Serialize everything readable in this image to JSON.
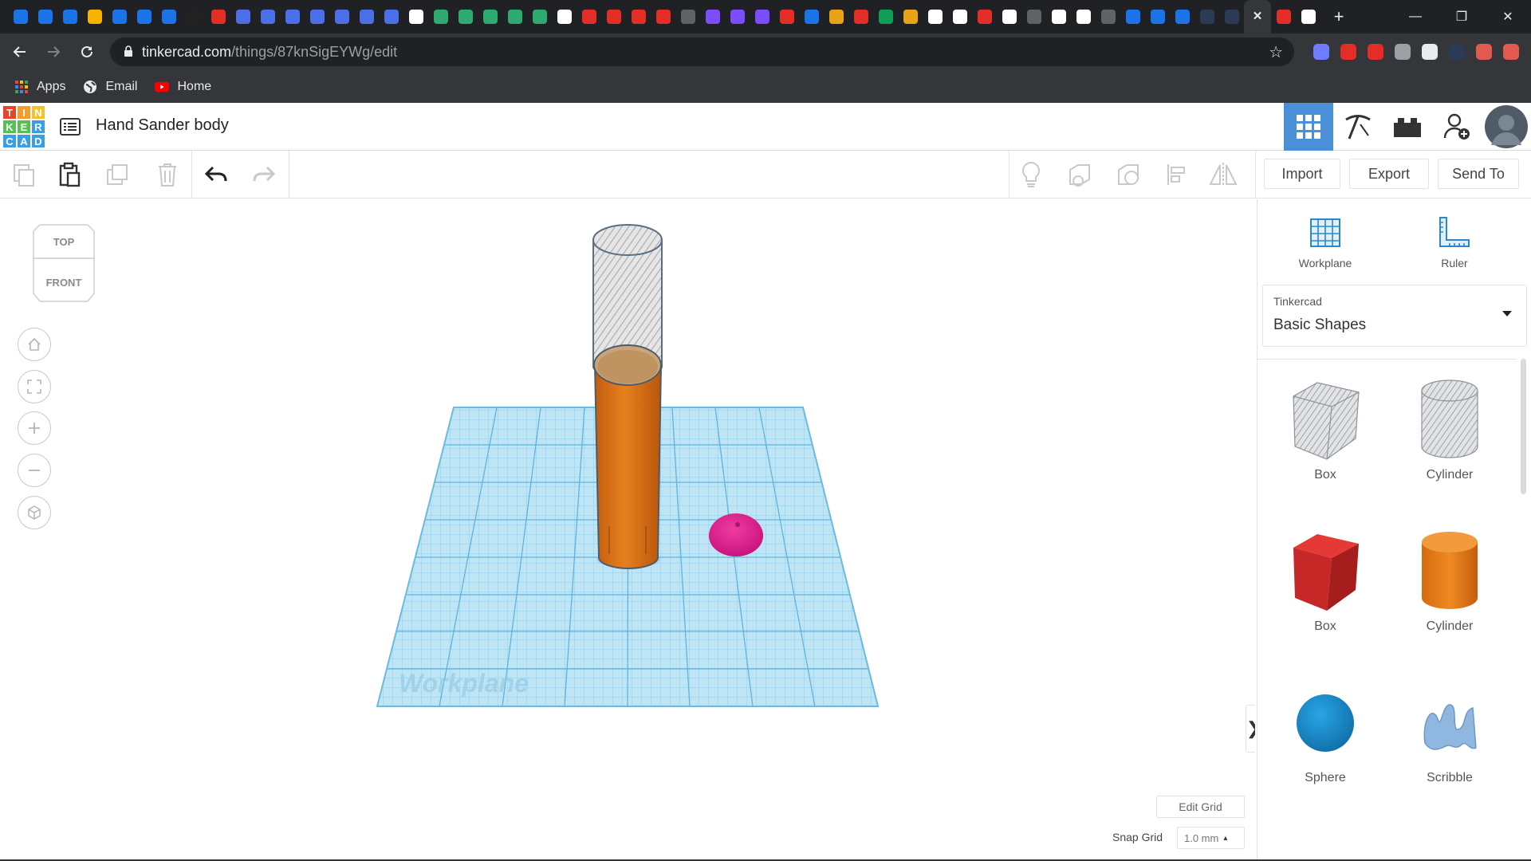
{
  "browser": {
    "tab_favicon_colors": [
      "#1a73e8",
      "#1a73e8",
      "#1a73e8",
      "#f6b400",
      "#1a73e8",
      "#1a73e8",
      "#1a73e8",
      "#222222",
      "#e52d27",
      "#4a6fe8",
      "#4a6fe8",
      "#4a6fe8",
      "#4a6fe8",
      "#4a6fe8",
      "#4a6fe8",
      "#4a6fe8",
      "#ffffff",
      "#2ea96f",
      "#2ea96f",
      "#2ea96f",
      "#2ea96f",
      "#2ea96f",
      "#ffffff",
      "#e52d27",
      "#e52d27",
      "#e52d27",
      "#e52d27",
      "#5f6368",
      "#7c4dff",
      "#7c4dff",
      "#7c4dff",
      "#e52d27",
      "#1a73e8",
      "#e8a317",
      "#e52d27",
      "#0f9d58",
      "#e8a317",
      "#ffffff",
      "#ffffff",
      "#e52d27",
      "#ffffff",
      "#5f6368",
      "#ffffff",
      "#ffffff",
      "#5f6368",
      "#1a73e8",
      "#1a73e8",
      "#1a73e8",
      "#2b3a55",
      "#2b3a55"
    ],
    "active_tab_close": "✕",
    "after_tabs_favicon_colors": [
      "#e52d27",
      "#ffffff"
    ],
    "new_tab": "+",
    "window_controls": [
      "—",
      "❐",
      "✕"
    ],
    "url_host": "tinkercad.com",
    "url_path": "/things/87knSigEYWg/edit",
    "extension_colors": [
      "#6f7cff",
      "#e52d27",
      "#e52d27",
      "#9aa0a6",
      "#e8eaed",
      "#2b3a55",
      "#e05a4f",
      "#e05a4f"
    ],
    "bookmarks": [
      {
        "label": "Apps",
        "icon": "apps-grid-icon"
      },
      {
        "label": "Email",
        "icon": "globe-icon"
      },
      {
        "label": "Home",
        "icon": "youtube-icon"
      }
    ]
  },
  "app": {
    "logo_letters": [
      "T",
      "I",
      "N",
      "K",
      "E",
      "R",
      "C",
      "A",
      "D"
    ],
    "logo_colors": [
      "#e8442a",
      "#f29d2e",
      "#f2c12e",
      "#5bbd55",
      "#5bbd55",
      "#3b9ee2",
      "#3b9ee2",
      "#3b9ee2",
      "#3b9ee2"
    ],
    "design_title": "Hand Sander body",
    "toolbar": {
      "import_label": "Import",
      "export_label": "Export",
      "send_to_label": "Send To"
    },
    "panel": {
      "workplane_label": "Workplane",
      "ruler_label": "Ruler",
      "library_category": "Tinkercad",
      "library_name": "Basic Shapes",
      "shapes": [
        {
          "label": "Box",
          "kind": "hole-box"
        },
        {
          "label": "Cylinder",
          "kind": "hole-cylinder"
        },
        {
          "label": "Box",
          "kind": "solid-box",
          "color": "#d32f2f"
        },
        {
          "label": "Cylinder",
          "kind": "solid-cylinder",
          "color": "#e67e22"
        },
        {
          "label": "Sphere",
          "kind": "sphere",
          "color": "#1e8fd1"
        },
        {
          "label": "Scribble",
          "kind": "scribble",
          "color": "#8fb7df"
        }
      ]
    },
    "viewcube": {
      "top": "TOP",
      "front": "FRONT"
    },
    "workplane_watermark": "Workplane",
    "edit_grid_label": "Edit Grid",
    "snap_grid_label": "Snap Grid",
    "snap_grid_value": "1.0 mm",
    "snap_grid_caret": "▴",
    "collapse_arrow": "❯"
  }
}
